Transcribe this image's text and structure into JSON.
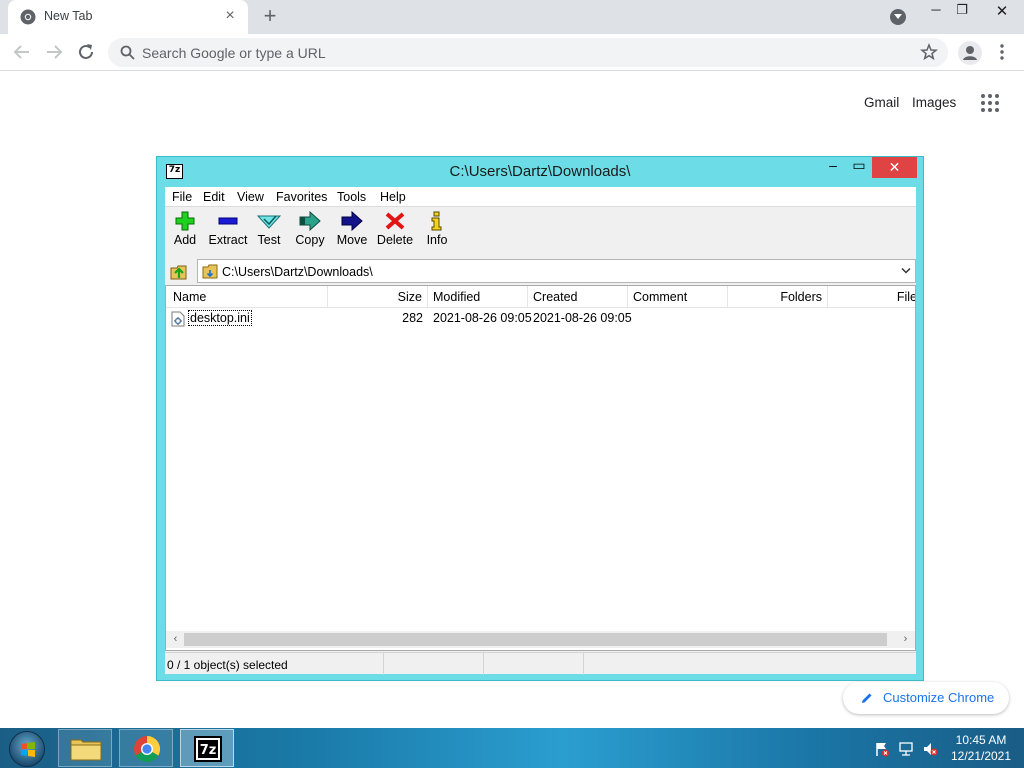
{
  "browser": {
    "tab_title": "New Tab",
    "omnibox_placeholder": "Search Google or type a URL",
    "links": {
      "gmail": "Gmail",
      "images": "Images"
    },
    "customize_label": "Customize Chrome"
  },
  "sevenzip": {
    "title": "C:\\Users\\Dartz\\Downloads\\",
    "app_icon_text": "7z",
    "menu": [
      "File",
      "Edit",
      "View",
      "Favorites",
      "Tools",
      "Help"
    ],
    "toolbar": [
      {
        "label": "Add",
        "icon": "add-icon"
      },
      {
        "label": "Extract",
        "icon": "extract-icon"
      },
      {
        "label": "Test",
        "icon": "test-icon"
      },
      {
        "label": "Copy",
        "icon": "copy-icon"
      },
      {
        "label": "Move",
        "icon": "move-icon"
      },
      {
        "label": "Delete",
        "icon": "delete-icon"
      },
      {
        "label": "Info",
        "icon": "info-icon"
      }
    ],
    "address": "C:\\Users\\Dartz\\Downloads\\",
    "columns": [
      "Name",
      "Size",
      "Modified",
      "Created",
      "Comment",
      "Folders",
      "File"
    ],
    "files": [
      {
        "name": "desktop.ini",
        "size": "282",
        "modified": "2021-08-26 09:05",
        "created": "2021-08-26 09:05"
      }
    ],
    "status": "0 / 1 object(s) selected"
  },
  "taskbar": {
    "pinned": [
      "file-explorer",
      "google-chrome",
      "7-zip"
    ],
    "time": "10:45 AM",
    "date": "12/21/2021"
  },
  "colors": {
    "window_frame": "#6cdde6",
    "close_button": "#e04343",
    "link_blue": "#1a73e8"
  }
}
